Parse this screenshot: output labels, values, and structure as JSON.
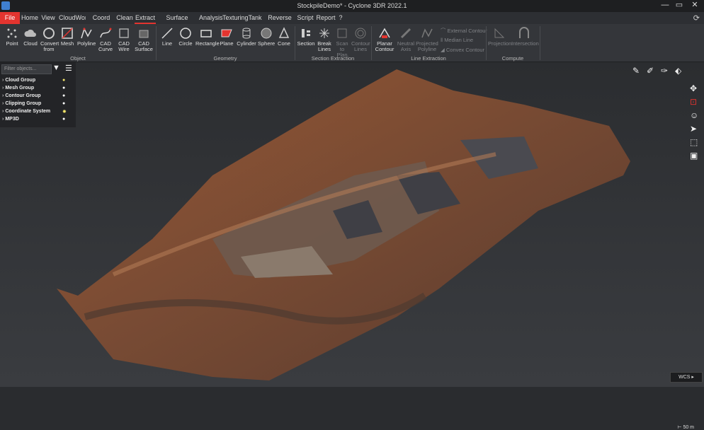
{
  "window": {
    "title": "StockpileDemo* - Cyclone 3DR 2022.1",
    "minimize": "—",
    "maximize": "▭",
    "close": "✕"
  },
  "menu": [
    "File",
    "Home",
    "View",
    "CloudWorx",
    "Coord Sys",
    "Clean",
    "Extract",
    "Surface Modeling",
    "Analysis",
    "Texturing",
    "Tank",
    "Reverse Eng",
    "Script",
    "Report",
    "?"
  ],
  "menu_active": "Extract",
  "ribbon": {
    "object": {
      "label": "Object",
      "tools": [
        [
          "Point",
          ""
        ],
        [
          "Cloud",
          ""
        ],
        [
          "Convert",
          "from"
        ],
        [
          "Mesh",
          ""
        ],
        [
          "Polyline",
          ""
        ],
        [
          "CAD",
          "Curve"
        ],
        [
          "CAD",
          "Wire"
        ],
        [
          "CAD",
          "Surface"
        ]
      ]
    },
    "geometry": {
      "label": "Geometry",
      "tools": [
        "Line",
        "Circle",
        "Rectangle",
        "Plane",
        "Cylinder",
        "Sphere",
        "Cone"
      ]
    },
    "section": {
      "label": "Section Extraction",
      "tools": [
        [
          "Section",
          ""
        ],
        [
          "Break",
          "Lines"
        ],
        [
          "Scan to",
          "Plan"
        ],
        [
          "Contour",
          "Lines"
        ]
      ]
    },
    "line": {
      "label": "Line Extraction",
      "tools": [
        [
          "Planar",
          "Contour"
        ],
        [
          "Neutral",
          "Axis"
        ],
        [
          "Projected",
          "Polyline"
        ]
      ],
      "small": [
        "External Contour",
        "Median Line",
        "Convex Contour"
      ]
    },
    "compute": {
      "label": "Compute",
      "tools": [
        "Projection",
        "Intersection"
      ]
    }
  },
  "sidebar": {
    "filter_placeholder": "Filter objects...",
    "items": [
      "Cloud Group",
      "Mesh Group",
      "Contour Group",
      "Clipping Group",
      "Coordinate System",
      "MP3D"
    ]
  },
  "viewport": {
    "scale_label": "50 m",
    "coord_label": "WCS"
  }
}
